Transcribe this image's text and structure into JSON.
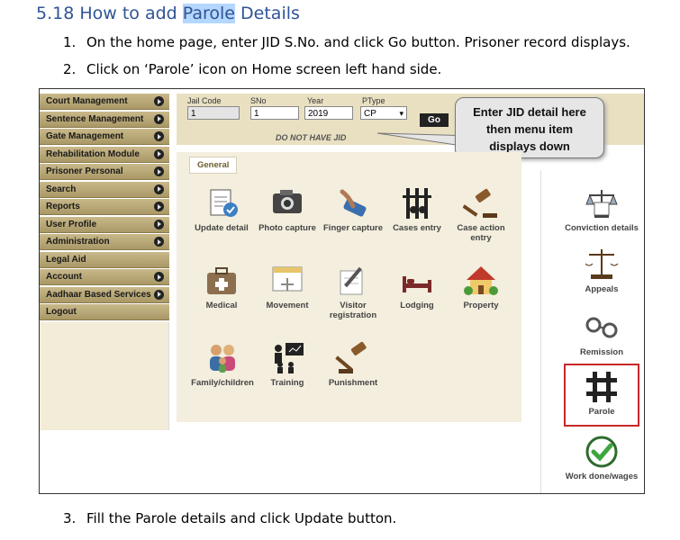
{
  "heading": {
    "prefix": "5.18 How to add ",
    "highlight": "Parole",
    "suffix": " Details"
  },
  "steps": [
    {
      "num": "1.",
      "text": "On the home page, enter JID S.No. and click Go button. Prisoner record displays."
    },
    {
      "num": "2.",
      "text": "Click on ‘Parole’ icon on Home screen left hand side."
    },
    {
      "num": "3.",
      "text": "Fill the Parole details and click Update button."
    }
  ],
  "menu": [
    {
      "label": "Court Management",
      "arrow": true
    },
    {
      "label": "Sentence Management",
      "arrow": true
    },
    {
      "label": "Gate Management",
      "arrow": true
    },
    {
      "label": "Rehabilitation Module",
      "arrow": true
    },
    {
      "label": "Prisoner Personal",
      "arrow": true
    },
    {
      "label": "Search",
      "arrow": true
    },
    {
      "label": "Reports",
      "arrow": true
    },
    {
      "label": "User Profile",
      "arrow": true
    },
    {
      "label": "Administration",
      "arrow": true
    },
    {
      "label": "Legal Aid",
      "arrow": false
    },
    {
      "label": "Account",
      "arrow": true
    },
    {
      "label": "Aadhaar Based Services",
      "arrow": true
    },
    {
      "label": "Logout",
      "arrow": false
    }
  ],
  "form": {
    "jail_code_label": "Jail Code",
    "jail_code_value": "1",
    "sno_label": "SNo",
    "sno_value": "1",
    "year_label": "Year",
    "year_value": "2019",
    "ptype_label": "PType",
    "ptype_value": "CP",
    "go_label": "Go",
    "no_jid": "DO NOT HAVE JID"
  },
  "callout": {
    "line1": "Enter JID detail here",
    "line2": "then menu item",
    "line3": "displays down"
  },
  "tab": "General",
  "icons": {
    "update_detail": "Update detail",
    "photo_capture": "Photo capture",
    "finger_capture": "Finger capture",
    "cases_entry": "Cases entry",
    "case_action": "Case action entry",
    "medical": "Medical",
    "movement": "Movement",
    "visitor": "Visitor registration",
    "lodging": "Lodging",
    "property": "Property",
    "family": "Family/children",
    "training": "Training",
    "punishment": "Punishment",
    "conviction": "Conviction details",
    "appeals": "Appeals",
    "remission": "Remission",
    "parole": "Parole",
    "work": "Work done/wages"
  }
}
